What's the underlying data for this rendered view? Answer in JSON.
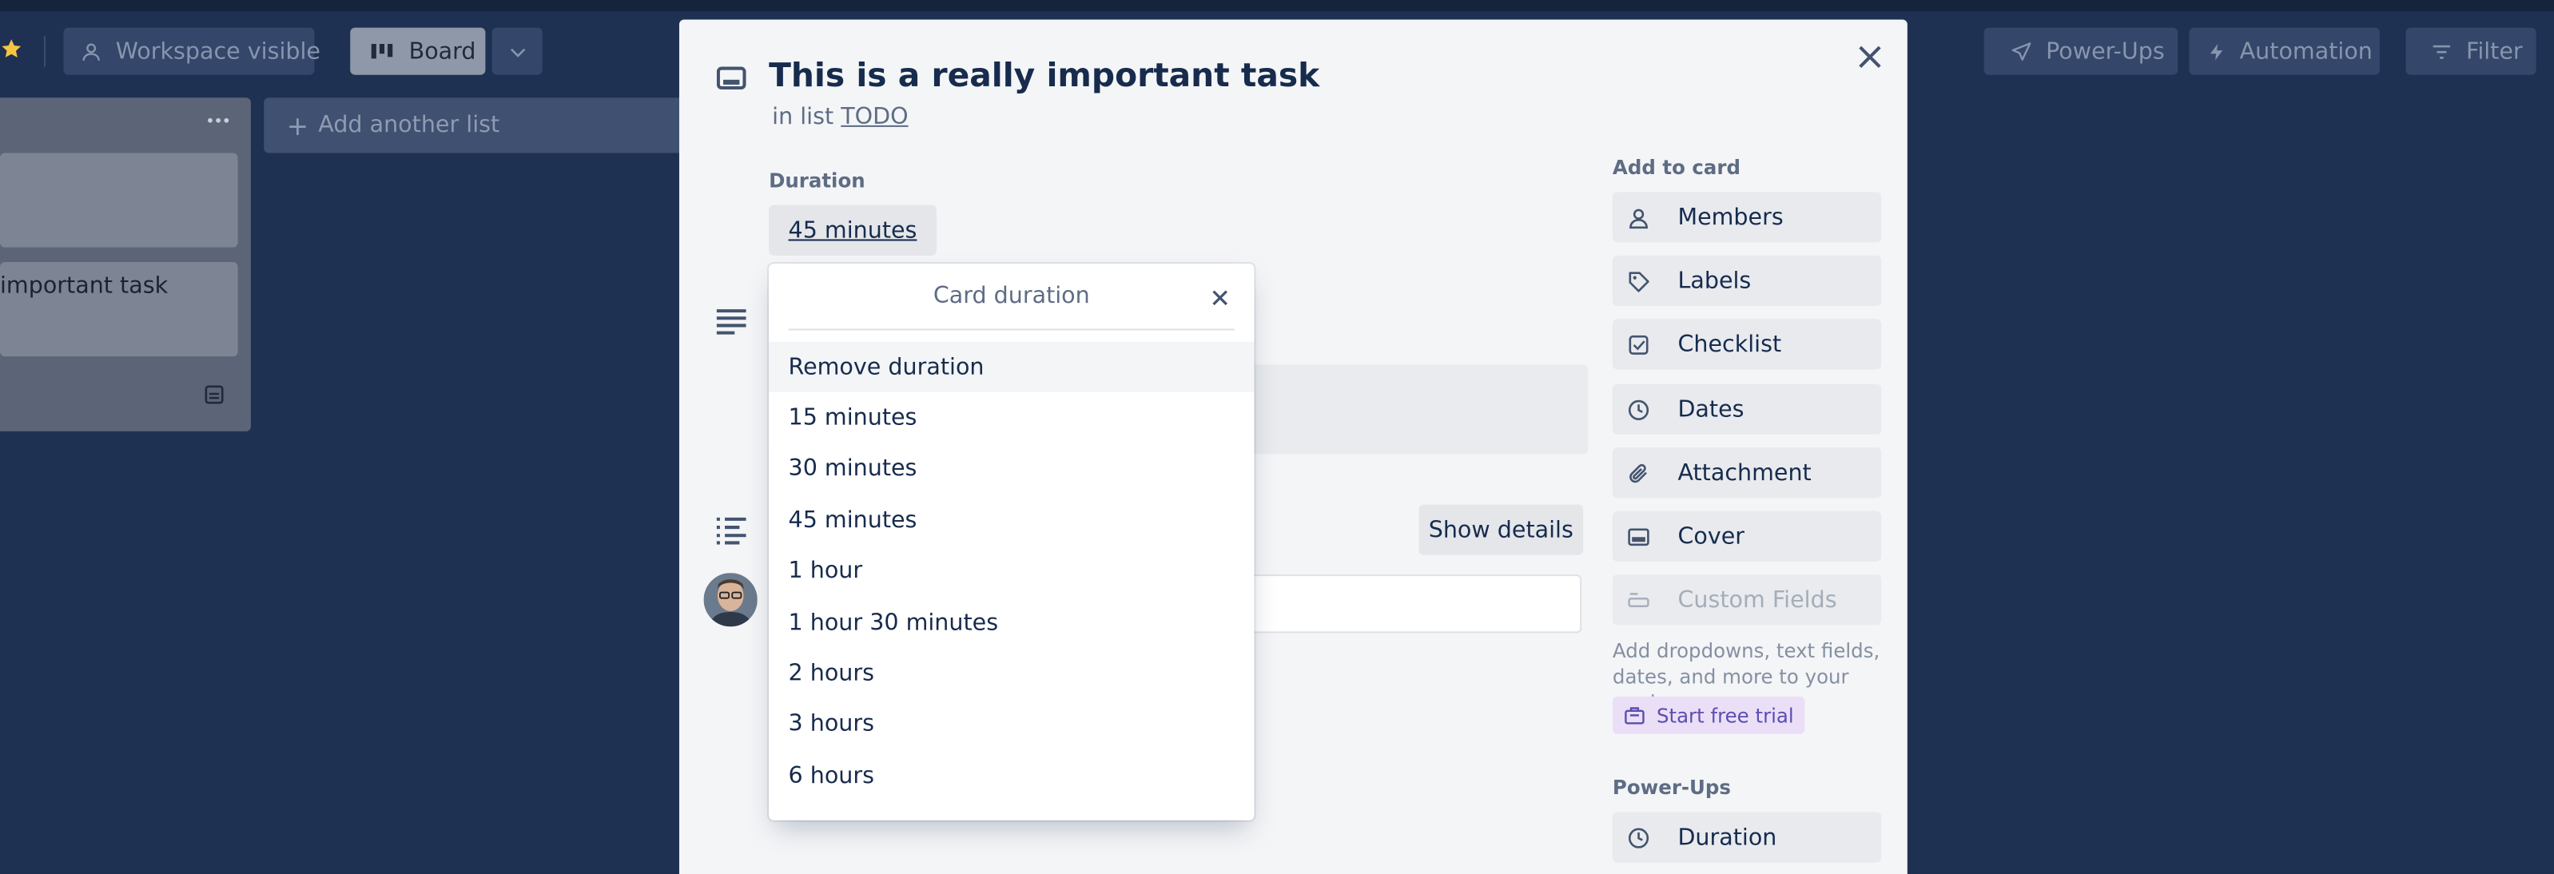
{
  "header": {
    "visibility_label": "Workspace visible",
    "view_label": "Board",
    "powerups_label": "Power-Ups",
    "automation_label": "Automation",
    "filter_label": "Filter"
  },
  "board": {
    "add_list_label": "Add another list",
    "card_text": "important task"
  },
  "card_modal": {
    "title": "This is a really important task",
    "in_list_prefix": "in list",
    "list_name": "TODO",
    "duration_heading": "Duration",
    "duration_value": "45 minutes",
    "show_details_label": "Show details"
  },
  "sidebar": {
    "add_to_card_heading": "Add to card",
    "items": [
      {
        "label": "Members",
        "icon": "person-icon"
      },
      {
        "label": "Labels",
        "icon": "tag-icon"
      },
      {
        "label": "Checklist",
        "icon": "checkbox-icon"
      },
      {
        "label": "Dates",
        "icon": "clock-icon"
      },
      {
        "label": "Attachment",
        "icon": "paperclip-icon"
      },
      {
        "label": "Cover",
        "icon": "cover-icon"
      }
    ],
    "custom_fields_label": "Custom Fields",
    "custom_fields_note": "Add dropdowns, text fields, dates, and more to your cards.",
    "trial_label": "Start free trial",
    "powerups_heading": "Power-Ups",
    "duration_button_label": "Duration"
  },
  "duration_popover": {
    "title": "Card duration",
    "options": [
      "Remove duration",
      "15 minutes",
      "30 minutes",
      "45 minutes",
      "1 hour",
      "1 hour 30 minutes",
      "2 hours",
      "3 hours",
      "6 hours"
    ]
  },
  "colors": {
    "board_background": "#1f3152",
    "modal_background": "#f4f5f7",
    "text_primary": "#172b4d",
    "text_secondary": "#5e6c84",
    "trial_badge": "#eadff6",
    "star": "#f5c542"
  }
}
